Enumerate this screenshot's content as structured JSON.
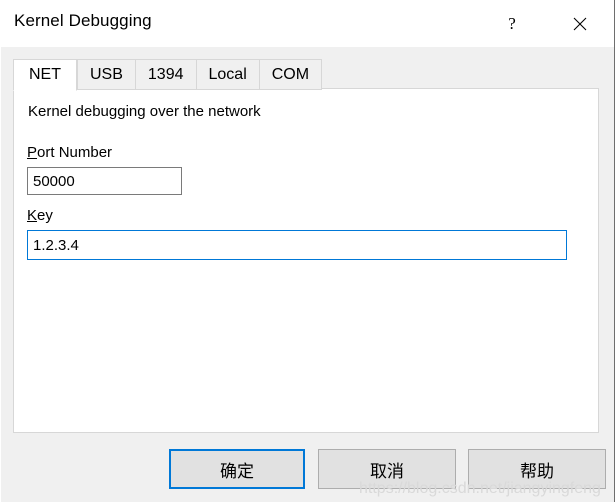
{
  "window": {
    "title": "Kernel Debugging",
    "caption_buttons": [
      {
        "name": "help-caption-button",
        "glyph": "?"
      },
      {
        "name": "close-caption-button",
        "glyph": "✕"
      }
    ]
  },
  "tabs": [
    {
      "label": "NET",
      "active": true
    },
    {
      "label": "USB",
      "active": false
    },
    {
      "label": "1394",
      "active": false
    },
    {
      "label": "Local",
      "active": false
    },
    {
      "label": "COM",
      "active": false
    }
  ],
  "panel": {
    "description": "Kernel debugging over the network",
    "fields": [
      {
        "label_accel": "P",
        "label_rest": "ort Number",
        "label_full": "Port Number",
        "value": "50000",
        "placeholder": "",
        "focused": false
      },
      {
        "label_accel": "K",
        "label_rest": "ey",
        "label_full": "Key",
        "value": "1.2.3.4",
        "placeholder": "",
        "focused": true
      }
    ]
  },
  "buttons": {
    "ok": "确定",
    "cancel": "取消",
    "help": "帮助"
  },
  "watermark": "https://blog.csdn.net/jiangyingfeng",
  "colors": {
    "accent": "#0078d7",
    "dialog_bg": "#f0f0f0",
    "panel_bg": "#ffffff",
    "button_bg": "#e1e1e1",
    "border": "#d7d7d7",
    "watermark": "#d9d9d9"
  }
}
